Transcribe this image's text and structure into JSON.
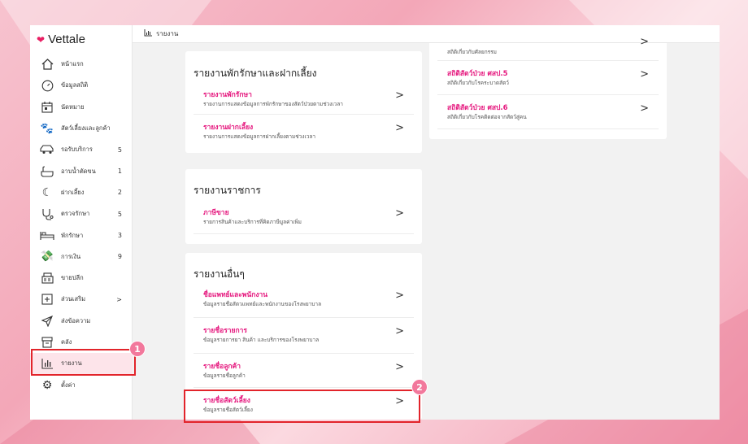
{
  "app": {
    "brand": "Vettale"
  },
  "topbar": {
    "icon": "chart-icon",
    "title": "รายงาน"
  },
  "sidebar": {
    "items": [
      {
        "label": "หน้าแรก",
        "icon": "home-icon",
        "count": ""
      },
      {
        "label": "ข้อมูลสถิติ",
        "icon": "gauge-icon",
        "count": ""
      },
      {
        "label": "นัดหมาย",
        "icon": "calendar-icon",
        "count": ""
      },
      {
        "label": "สัตว์เลี้ยงและลูกค้า",
        "icon": "paw-icon",
        "count": ""
      },
      {
        "label": "รอรับบริการ",
        "icon": "car-icon",
        "count": "5"
      },
      {
        "label": "อาบน้ำตัดขน",
        "icon": "bathtub-icon",
        "count": "1"
      },
      {
        "label": "ฝากเลี้ยง",
        "icon": "moon-icon",
        "count": "2"
      },
      {
        "label": "ตรวจรักษา",
        "icon": "stethoscope-icon",
        "count": "5"
      },
      {
        "label": "พักรักษา",
        "icon": "bed-icon",
        "count": "3"
      },
      {
        "label": "การเงิน",
        "icon": "money-hand-icon",
        "count": "9"
      },
      {
        "label": "ขายปลีก",
        "icon": "cash-register-icon",
        "count": ""
      },
      {
        "label": "ส่วนเสริม",
        "icon": "plus-box-icon",
        "count": ">"
      },
      {
        "label": "ส่งข้อความ",
        "icon": "send-icon",
        "count": ""
      },
      {
        "label": "คลัง",
        "icon": "inventory-icon",
        "count": ""
      },
      {
        "label": "รายงาน",
        "icon": "report-icon",
        "count": ""
      },
      {
        "label": "ตั้งค่า",
        "icon": "settings-icon",
        "count": ""
      }
    ]
  },
  "cards": {
    "boarding": {
      "title": "รายงานพักรักษาและฝากเลี้ยง",
      "rows": [
        {
          "title": "รายงานพักรักษา",
          "desc": "รายงานการแสดงข้อมูลการพักรักษาของสัตว์ป่วยตามช่วงเวลา"
        },
        {
          "title": "รายงานฝากเลี้ยง",
          "desc": "รายงานการแสดงข้อมูลการฝากเลี้ยงตามช่วงเวลา"
        }
      ]
    },
    "official": {
      "title": "รายงานราชการ",
      "rows": [
        {
          "title": "ภาษีขาย",
          "desc": "รายการสินค้าและบริการที่คิดภาษีมูลค่าเพิ่ม"
        }
      ]
    },
    "other": {
      "title": "รายงานอื่นๆ",
      "rows": [
        {
          "title": "ชื่อแพทย์และพนักงาน",
          "desc": "ข้อมูลรายชื่อสัตวแพทย์และพนักงานของโรงพยาบาล"
        },
        {
          "title": "รายชื่อรายการ",
          "desc": "ข้อมูลรายการยา สินค้า และบริการของโรงพยาบาล"
        },
        {
          "title": "รายชื่อลูกค้า",
          "desc": "ข้อมูลรายชื่อลูกค้า"
        },
        {
          "title": "รายชื่อสัตว์เลี้ยง",
          "desc": "ข้อมูลรายชื่อสัตว์เลี้ยง"
        }
      ]
    },
    "stats": {
      "rows": [
        {
          "title": "",
          "desc": "สถิติเกี่ยวกับศัลยกรรม"
        },
        {
          "title": "สถิติสัตว์ป่วย ศสป.5",
          "desc": "สถิติเกี่ยวกับโรคระบาดสัตว์"
        },
        {
          "title": "สถิติสัตว์ป่วย ศสป.6",
          "desc": "สถิติเกี่ยวกับโรคติดต่อจากสัตว์สู่คน"
        }
      ]
    }
  },
  "chevron": ">",
  "annotations": {
    "badge1": "1",
    "badge2": "2"
  },
  "colors": {
    "accent": "#e5167d",
    "highlight": "#e2242b",
    "badge": "#f2789c"
  }
}
